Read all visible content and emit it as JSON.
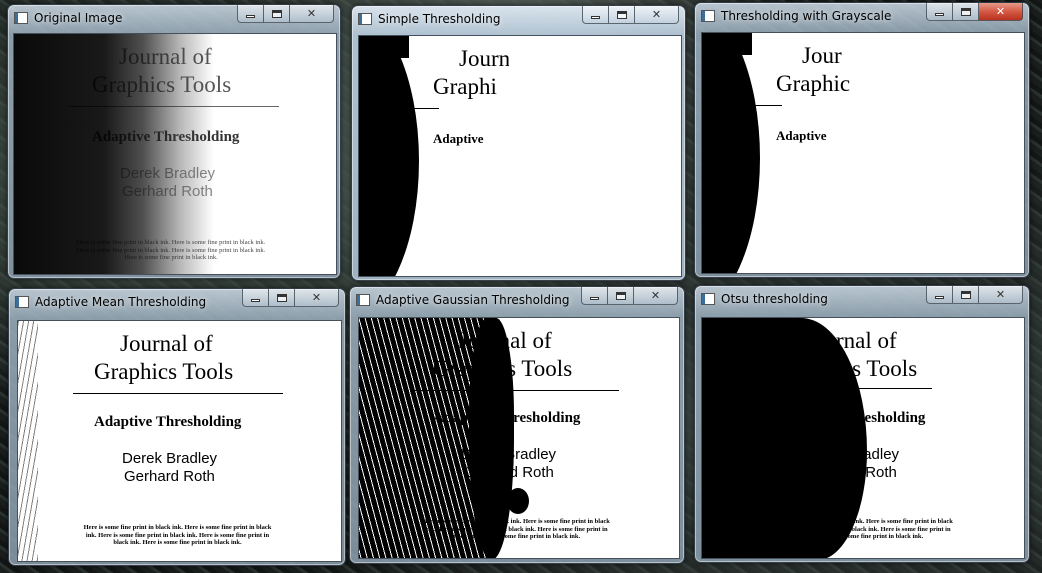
{
  "windows": [
    {
      "title": "Original Image"
    },
    {
      "title": "Simple Thresholding"
    },
    {
      "title": "Thresholding with Grayscale"
    },
    {
      "title": "Adaptive Mean Thresholding"
    },
    {
      "title": "Adaptive Gaussian Thresholding"
    },
    {
      "title": "Otsu thresholding"
    }
  ],
  "controls": {
    "minimize": "",
    "maximize": "",
    "close": "✕"
  },
  "document": {
    "journal_line1": "Journal of",
    "journal_line2": "Graphics Tools",
    "heading": "Adaptive Thresholding",
    "author1": "Derek Bradley",
    "author2": "Gerhard Roth",
    "fine_print": "Here is some fine print in black ink.  Here is some fine print in black ink.  Here is some fine print in black ink.  Here is some fine print in black ink.  Here is some fine print in black ink."
  },
  "partial": {
    "journal_line1": "Journ",
    "journal_line2": "Graphi",
    "heading": "Adaptive",
    "journal_line1_b": "Jour",
    "journal_line2_b": "Graphic"
  }
}
